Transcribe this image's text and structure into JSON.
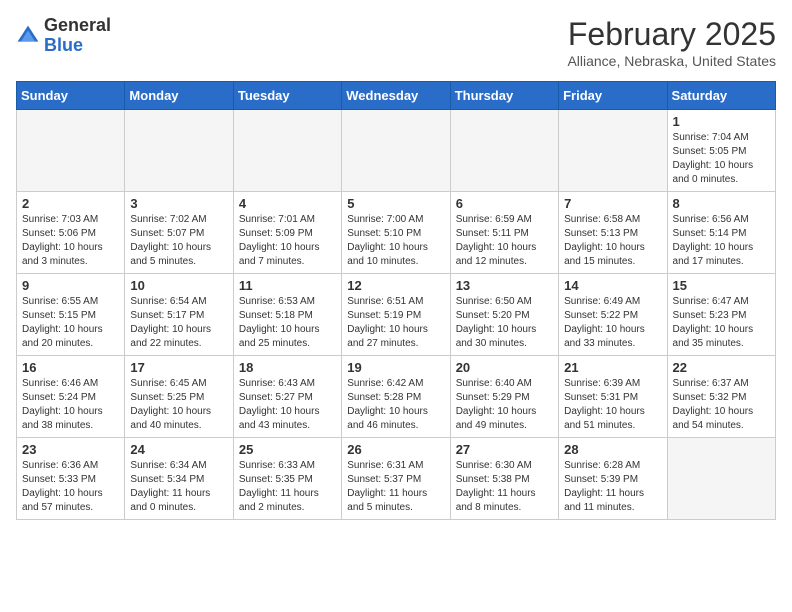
{
  "logo": {
    "general": "General",
    "blue": "Blue"
  },
  "header": {
    "title": "February 2025",
    "subtitle": "Alliance, Nebraska, United States"
  },
  "weekdays": [
    "Sunday",
    "Monday",
    "Tuesday",
    "Wednesday",
    "Thursday",
    "Friday",
    "Saturday"
  ],
  "weeks": [
    [
      {
        "day": "",
        "info": ""
      },
      {
        "day": "",
        "info": ""
      },
      {
        "day": "",
        "info": ""
      },
      {
        "day": "",
        "info": ""
      },
      {
        "day": "",
        "info": ""
      },
      {
        "day": "",
        "info": ""
      },
      {
        "day": "1",
        "info": "Sunrise: 7:04 AM\nSunset: 5:05 PM\nDaylight: 10 hours and 0 minutes."
      }
    ],
    [
      {
        "day": "2",
        "info": "Sunrise: 7:03 AM\nSunset: 5:06 PM\nDaylight: 10 hours and 3 minutes."
      },
      {
        "day": "3",
        "info": "Sunrise: 7:02 AM\nSunset: 5:07 PM\nDaylight: 10 hours and 5 minutes."
      },
      {
        "day": "4",
        "info": "Sunrise: 7:01 AM\nSunset: 5:09 PM\nDaylight: 10 hours and 7 minutes."
      },
      {
        "day": "5",
        "info": "Sunrise: 7:00 AM\nSunset: 5:10 PM\nDaylight: 10 hours and 10 minutes."
      },
      {
        "day": "6",
        "info": "Sunrise: 6:59 AM\nSunset: 5:11 PM\nDaylight: 10 hours and 12 minutes."
      },
      {
        "day": "7",
        "info": "Sunrise: 6:58 AM\nSunset: 5:13 PM\nDaylight: 10 hours and 15 minutes."
      },
      {
        "day": "8",
        "info": "Sunrise: 6:56 AM\nSunset: 5:14 PM\nDaylight: 10 hours and 17 minutes."
      }
    ],
    [
      {
        "day": "9",
        "info": "Sunrise: 6:55 AM\nSunset: 5:15 PM\nDaylight: 10 hours and 20 minutes."
      },
      {
        "day": "10",
        "info": "Sunrise: 6:54 AM\nSunset: 5:17 PM\nDaylight: 10 hours and 22 minutes."
      },
      {
        "day": "11",
        "info": "Sunrise: 6:53 AM\nSunset: 5:18 PM\nDaylight: 10 hours and 25 minutes."
      },
      {
        "day": "12",
        "info": "Sunrise: 6:51 AM\nSunset: 5:19 PM\nDaylight: 10 hours and 27 minutes."
      },
      {
        "day": "13",
        "info": "Sunrise: 6:50 AM\nSunset: 5:20 PM\nDaylight: 10 hours and 30 minutes."
      },
      {
        "day": "14",
        "info": "Sunrise: 6:49 AM\nSunset: 5:22 PM\nDaylight: 10 hours and 33 minutes."
      },
      {
        "day": "15",
        "info": "Sunrise: 6:47 AM\nSunset: 5:23 PM\nDaylight: 10 hours and 35 minutes."
      }
    ],
    [
      {
        "day": "16",
        "info": "Sunrise: 6:46 AM\nSunset: 5:24 PM\nDaylight: 10 hours and 38 minutes."
      },
      {
        "day": "17",
        "info": "Sunrise: 6:45 AM\nSunset: 5:25 PM\nDaylight: 10 hours and 40 minutes."
      },
      {
        "day": "18",
        "info": "Sunrise: 6:43 AM\nSunset: 5:27 PM\nDaylight: 10 hours and 43 minutes."
      },
      {
        "day": "19",
        "info": "Sunrise: 6:42 AM\nSunset: 5:28 PM\nDaylight: 10 hours and 46 minutes."
      },
      {
        "day": "20",
        "info": "Sunrise: 6:40 AM\nSunset: 5:29 PM\nDaylight: 10 hours and 49 minutes."
      },
      {
        "day": "21",
        "info": "Sunrise: 6:39 AM\nSunset: 5:31 PM\nDaylight: 10 hours and 51 minutes."
      },
      {
        "day": "22",
        "info": "Sunrise: 6:37 AM\nSunset: 5:32 PM\nDaylight: 10 hours and 54 minutes."
      }
    ],
    [
      {
        "day": "23",
        "info": "Sunrise: 6:36 AM\nSunset: 5:33 PM\nDaylight: 10 hours and 57 minutes."
      },
      {
        "day": "24",
        "info": "Sunrise: 6:34 AM\nSunset: 5:34 PM\nDaylight: 11 hours and 0 minutes."
      },
      {
        "day": "25",
        "info": "Sunrise: 6:33 AM\nSunset: 5:35 PM\nDaylight: 11 hours and 2 minutes."
      },
      {
        "day": "26",
        "info": "Sunrise: 6:31 AM\nSunset: 5:37 PM\nDaylight: 11 hours and 5 minutes."
      },
      {
        "day": "27",
        "info": "Sunrise: 6:30 AM\nSunset: 5:38 PM\nDaylight: 11 hours and 8 minutes."
      },
      {
        "day": "28",
        "info": "Sunrise: 6:28 AM\nSunset: 5:39 PM\nDaylight: 11 hours and 11 minutes."
      },
      {
        "day": "",
        "info": ""
      }
    ]
  ]
}
